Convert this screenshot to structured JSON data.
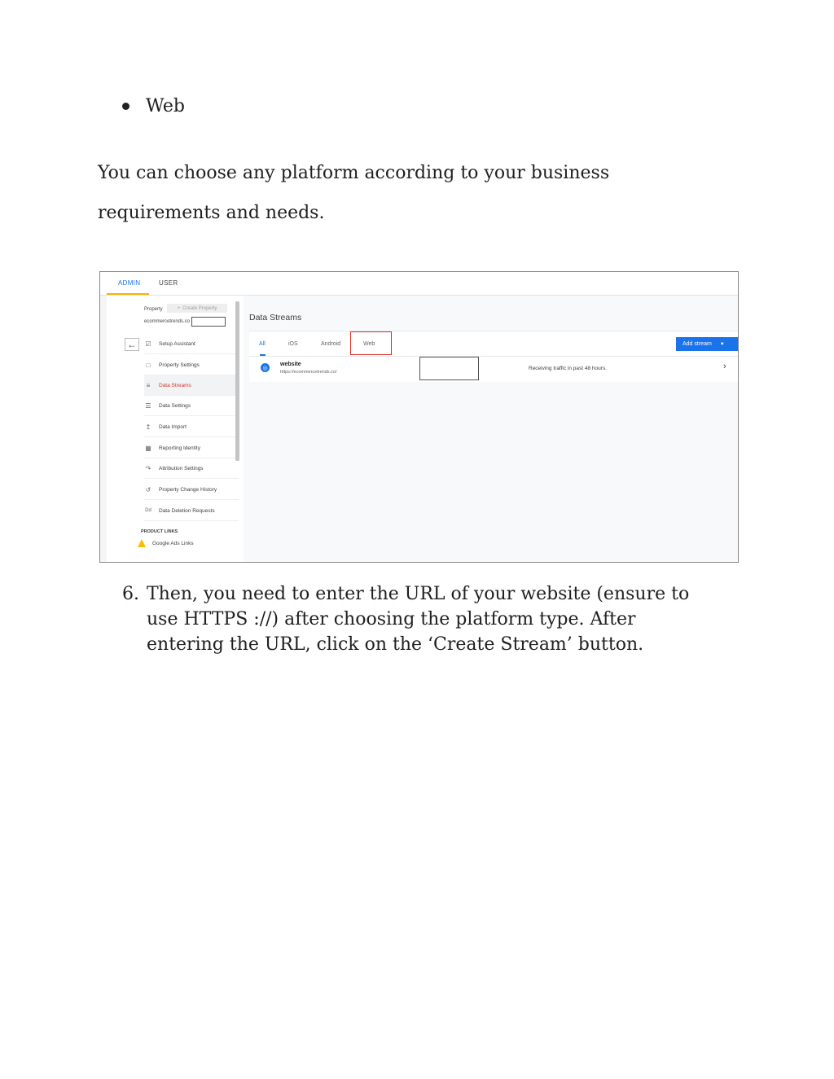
{
  "document": {
    "bullet_item": "Web",
    "paragraph": "You can choose any platform according to your business requirements and needs.",
    "step_number": "6.",
    "step_text": "Then, you need to enter the URL of your website (ensure to use HTTPS ://) after choosing the platform type. After entering the URL, click on the ‘Create Stream’ button."
  },
  "screenshot": {
    "top_tabs": {
      "admin": "ADMIN",
      "user": "USER"
    },
    "property_label": "Property",
    "create_property": "Create Property",
    "property_name": "ecommercetrends.co",
    "nav_items": [
      {
        "label": "Setup Assistant",
        "icon": "checkbox-icon"
      },
      {
        "label": "Property Settings",
        "icon": "property-icon"
      },
      {
        "label": "Data Streams",
        "icon": "streams-icon",
        "active": true
      },
      {
        "label": "Data Settings",
        "icon": "database-icon"
      },
      {
        "label": "Data Import",
        "icon": "upload-icon"
      },
      {
        "label": "Reporting Identity",
        "icon": "identity-icon"
      },
      {
        "label": "Attribution Settings",
        "icon": "attribution-icon"
      },
      {
        "label": "Property Change History",
        "icon": "history-icon"
      },
      {
        "label": "Data Deletion Requests",
        "icon": "dd-icon"
      }
    ],
    "product_links_heading": "PRODUCT LINKS",
    "google_ads_links": "Google Ads Links",
    "data_streams_title": "Data Streams",
    "filter_tabs": {
      "all": "All",
      "ios": "iOS",
      "android": "Android",
      "web": "Web"
    },
    "add_stream": "Add stream",
    "stream": {
      "name": "website",
      "url": "https://ecommercetrends.co/",
      "status": "Receiving traffic in past 48 hours."
    },
    "colors": {
      "accent": "#1a73e8",
      "highlight_box": "#d93025",
      "admin_underline": "#f4b400"
    }
  }
}
